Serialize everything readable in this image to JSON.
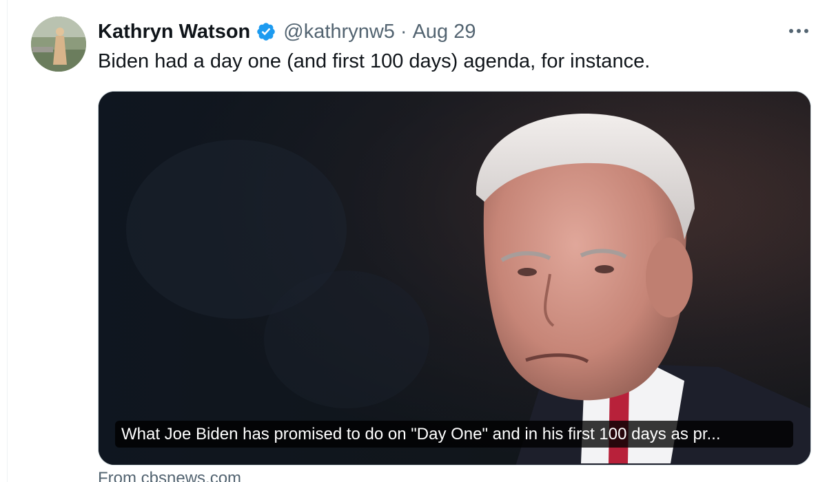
{
  "tweet": {
    "author": {
      "name": "Kathryn Watson",
      "handle": "@kathrynw5",
      "verified": true,
      "verified_color": "#1d9bf0"
    },
    "separator": "·",
    "timestamp": "Aug 29",
    "text": "Biden had a day one (and first 100 days) agenda, for instance.",
    "more_icon": "more-horizontal-icon"
  },
  "link_card": {
    "image_subject": "photo",
    "caption": "What Joe Biden has promised to do on \"Day One\" and in his first 100 days as pr...",
    "source": "From cbsnews.com"
  },
  "colors": {
    "text_primary": "#0f1419",
    "text_secondary": "#536471",
    "border": "#cfd9de"
  }
}
